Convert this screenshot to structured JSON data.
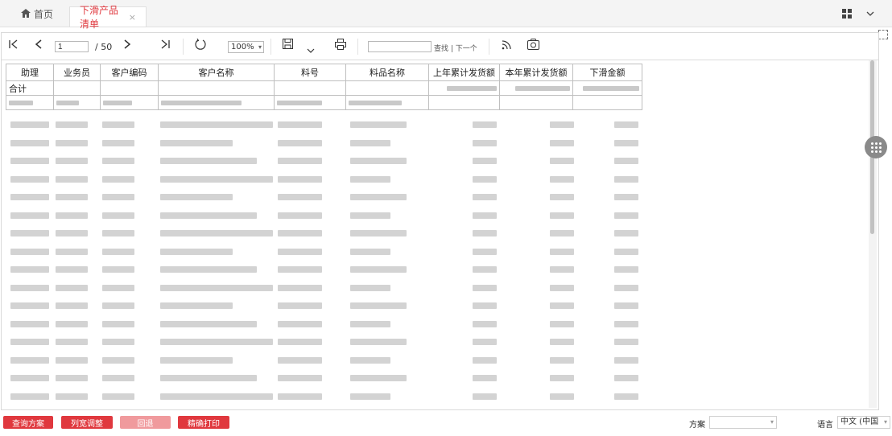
{
  "tabs": {
    "home_label": "首页",
    "active_label": "下滑产品清单",
    "close_symbol": "×"
  },
  "toolbar": {
    "first_symbol": "|◁",
    "prev_symbol": "‹",
    "page_value": "1",
    "page_total": "/ 50",
    "next_symbol": "›",
    "last_symbol": "▷|",
    "zoom_value": "100%",
    "find_placeholder": "",
    "find_label": "查找 | 下一个"
  },
  "table": {
    "headers": [
      "助理",
      "业务员",
      "客户编码",
      "客户名称",
      "料号",
      "料品名称",
      "上年累计发货额",
      "本年累计发货额",
      "下滑金额"
    ],
    "total_label": "合计"
  },
  "bottom": {
    "buttons": [
      "查询方案",
      "列宽调整",
      "回退",
      "精确打印"
    ],
    "scheme_label": "方案",
    "scheme_value": "",
    "language_label": "语言",
    "language_value": "中文 (中国"
  },
  "colors": {
    "accent": "#e0383e",
    "accent_disabled": "#f09a9d"
  }
}
